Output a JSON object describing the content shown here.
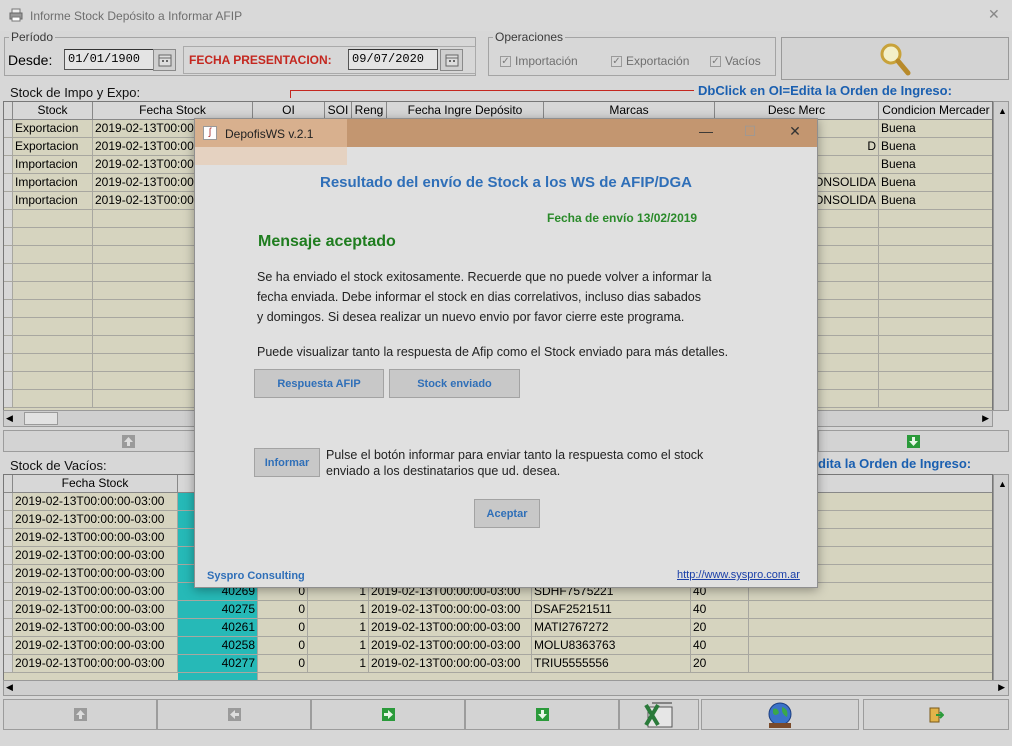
{
  "window": {
    "title": "Informe Stock Depósito a Informar AFIP"
  },
  "periodo": {
    "legend": "Período",
    "desde_label": "Desde:",
    "desde_value": "01/01/1900",
    "fecha_label": "FECHA PRESENTACION:",
    "fecha_value": "09/07/2020"
  },
  "operaciones": {
    "legend": "Operaciones",
    "importacion": "Importación",
    "exportacion": "Exportación",
    "vacios": "Vacíos"
  },
  "stock_impo": {
    "title": "Stock de Impo y Expo:",
    "hint": "DbClick en OI=Edita la Orden de Ingreso:",
    "columns": [
      "Stock",
      "Fecha Stock",
      "OI",
      "SOI",
      "Reng",
      "Fecha Ingre Depósito",
      "Marcas",
      "Desc Merc",
      "Condicion Mercader"
    ],
    "rows": [
      {
        "stock": "Exportacion",
        "fecha": "2019-02-13T00:00",
        "desc": "",
        "cond": "Buena"
      },
      {
        "stock": "Exportacion",
        "fecha": "2019-02-13T00:00",
        "desc": "D",
        "cond": "Buena"
      },
      {
        "stock": "Importacion",
        "fecha": "2019-02-13T00:00",
        "desc": "",
        "cond": "Buena"
      },
      {
        "stock": "Importacion",
        "fecha": "2019-02-13T00:00",
        "desc": "ONSOLIDA",
        "cond": "Buena"
      },
      {
        "stock": "Importacion",
        "fecha": "2019-02-13T00:00",
        "desc": "ONSOLIDA",
        "cond": "Buena"
      }
    ]
  },
  "stock_vacios": {
    "title": "Stock de Vacíos:",
    "hint": "dita la Orden de Ingreso:",
    "col_fecha": "Fecha Stock",
    "rows": [
      {
        "fecha": "2019-02-13T00:00:00-03:00",
        "oi": "",
        "soi": "",
        "reng": "",
        "ingreso": "",
        "cont": "",
        "size": ""
      },
      {
        "fecha": "2019-02-13T00:00:00-03:00",
        "oi": "",
        "soi": "",
        "reng": "",
        "ingreso": "",
        "cont": "",
        "size": ""
      },
      {
        "fecha": "2019-02-13T00:00:00-03:00",
        "oi": "",
        "soi": "",
        "reng": "",
        "ingreso": "",
        "cont": "",
        "size": ""
      },
      {
        "fecha": "2019-02-13T00:00:00-03:00",
        "oi": "",
        "soi": "",
        "reng": "",
        "ingreso": "",
        "cont": "",
        "size": ""
      },
      {
        "fecha": "2019-02-13T00:00:00-03:00",
        "oi": "",
        "soi": "",
        "reng": "",
        "ingreso": "",
        "cont": "",
        "size": ""
      },
      {
        "fecha": "2019-02-13T00:00:00-03:00",
        "oi": "40269",
        "soi": "0",
        "reng": "1",
        "ingreso": "2019-02-13T00:00:00-03:00",
        "cont": "SDHF7575221",
        "size": "40"
      },
      {
        "fecha": "2019-02-13T00:00:00-03:00",
        "oi": "40275",
        "soi": "0",
        "reng": "1",
        "ingreso": "2019-02-13T00:00:00-03:00",
        "cont": "DSAF2521511",
        "size": "40"
      },
      {
        "fecha": "2019-02-13T00:00:00-03:00",
        "oi": "40261",
        "soi": "0",
        "reng": "1",
        "ingreso": "2019-02-13T00:00:00-03:00",
        "cont": "MATI2767272",
        "size": "20"
      },
      {
        "fecha": "2019-02-13T00:00:00-03:00",
        "oi": "40258",
        "soi": "0",
        "reng": "1",
        "ingreso": "2019-02-13T00:00:00-03:00",
        "cont": "MOLU8363763",
        "size": "40"
      },
      {
        "fecha": "2019-02-13T00:00:00-03:00",
        "oi": "40277",
        "soi": "0",
        "reng": "1",
        "ingreso": "2019-02-13T00:00:00-03:00",
        "cont": "TRIU5555556",
        "size": "20"
      }
    ]
  },
  "dialog": {
    "title": "DepofisWS v.2.1",
    "heading": "Resultado del envío de Stock a los WS de AFIP/DGA",
    "date": "Fecha de envío 13/02/2019",
    "status": "Mensaje aceptado",
    "line1": "Se ha enviado el stock exitosamente. Recuerde que no puede volver a informar la",
    "line2": "fecha enviada. Debe informar el stock en dias correlativos, incluso dias sabados",
    "line3": "y domingos. Si desea realizar un nuevo envio por favor cierre este programa.",
    "line4": "Puede visualizar tanto la respuesta de Afip como el Stock enviado para más detalles.",
    "btn_respuesta": "Respuesta AFIP",
    "btn_stock": "Stock enviado",
    "btn_informar": "Informar",
    "informar_text1": "Pulse el botón informar para enviar tanto la respuesta como el stock",
    "informar_text2": "enviado a los destinatarios que ud. desea.",
    "btn_aceptar": "Aceptar",
    "footer_left": "Syspro Consulting",
    "footer_link": "http://www.syspro.com.ar"
  }
}
